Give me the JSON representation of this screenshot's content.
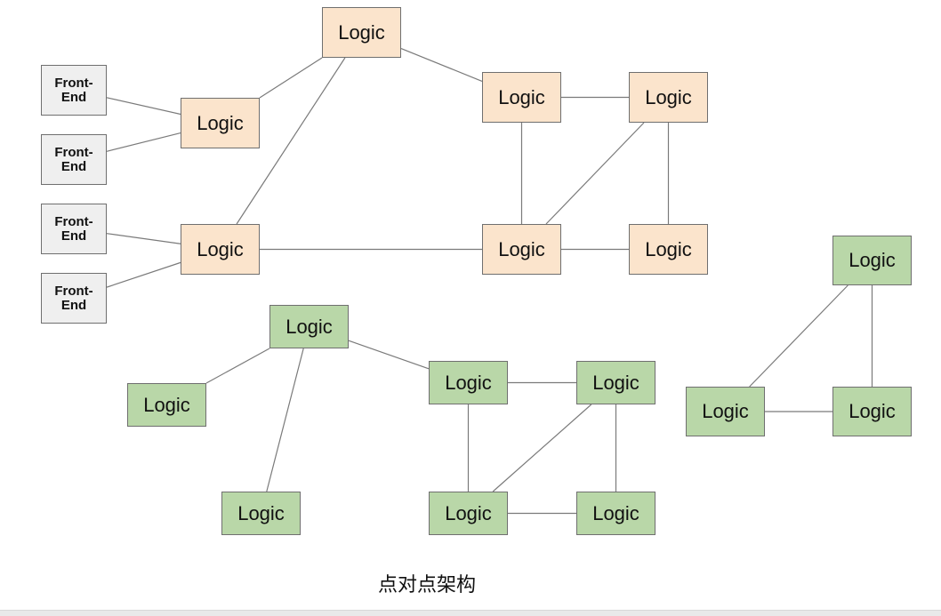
{
  "diagram": {
    "caption": "点对点架构",
    "colors": {
      "frontend_fill": "#efefef",
      "logic_orange_fill": "#fbe4cc",
      "logic_green_fill": "#b9d7a8",
      "border": "#6f6f6f",
      "edge": "#7a7a7a"
    },
    "nodes": [
      {
        "id": "fe1",
        "label": "Front-\nEnd",
        "kind": "frontend"
      },
      {
        "id": "fe2",
        "label": "Front-\nEnd",
        "kind": "frontend"
      },
      {
        "id": "fe3",
        "label": "Front-\nEnd",
        "kind": "frontend"
      },
      {
        "id": "fe4",
        "label": "Front-\nEnd",
        "kind": "frontend"
      },
      {
        "id": "o_l1",
        "label": "Logic",
        "kind": "logic-orange"
      },
      {
        "id": "o_l2",
        "label": "Logic",
        "kind": "logic-orange"
      },
      {
        "id": "o_top",
        "label": "Logic",
        "kind": "logic-orange"
      },
      {
        "id": "o_m1",
        "label": "Logic",
        "kind": "logic-orange"
      },
      {
        "id": "o_m2",
        "label": "Logic",
        "kind": "logic-orange"
      },
      {
        "id": "o_r1",
        "label": "Logic",
        "kind": "logic-orange"
      },
      {
        "id": "o_r2",
        "label": "Logic",
        "kind": "logic-orange"
      },
      {
        "id": "g_top",
        "label": "Logic",
        "kind": "logic-green"
      },
      {
        "id": "g_left",
        "label": "Logic",
        "kind": "logic-green"
      },
      {
        "id": "g_bot",
        "label": "Logic",
        "kind": "logic-green"
      },
      {
        "id": "g_m1",
        "label": "Logic",
        "kind": "logic-green"
      },
      {
        "id": "g_m2",
        "label": "Logic",
        "kind": "logic-green"
      },
      {
        "id": "g_r1",
        "label": "Logic",
        "kind": "logic-green"
      },
      {
        "id": "g_r2",
        "label": "Logic",
        "kind": "logic-green"
      },
      {
        "id": "t_top",
        "label": "Logic",
        "kind": "logic-green"
      },
      {
        "id": "t_left",
        "label": "Logic",
        "kind": "logic-green"
      },
      {
        "id": "t_right",
        "label": "Logic",
        "kind": "logic-green"
      }
    ],
    "edges": [
      [
        "fe1",
        "o_l1"
      ],
      [
        "fe2",
        "o_l1"
      ],
      [
        "fe3",
        "o_l2"
      ],
      [
        "fe4",
        "o_l2"
      ],
      [
        "o_l1",
        "o_top"
      ],
      [
        "o_l2",
        "o_top"
      ],
      [
        "o_top",
        "o_m1"
      ],
      [
        "o_m1",
        "o_r1"
      ],
      [
        "o_m1",
        "o_m2"
      ],
      [
        "o_r1",
        "o_m2"
      ],
      [
        "o_r1",
        "o_r2"
      ],
      [
        "o_l2",
        "o_m2"
      ],
      [
        "o_m2",
        "o_r2"
      ],
      [
        "g_top",
        "g_left"
      ],
      [
        "g_top",
        "g_bot"
      ],
      [
        "g_top",
        "g_m1"
      ],
      [
        "g_m1",
        "g_r1"
      ],
      [
        "g_m1",
        "g_m2"
      ],
      [
        "g_r1",
        "g_m2"
      ],
      [
        "g_r1",
        "g_r2"
      ],
      [
        "g_m2",
        "g_r2"
      ],
      [
        "t_top",
        "t_left"
      ],
      [
        "t_top",
        "t_right"
      ],
      [
        "t_left",
        "t_right"
      ]
    ]
  }
}
